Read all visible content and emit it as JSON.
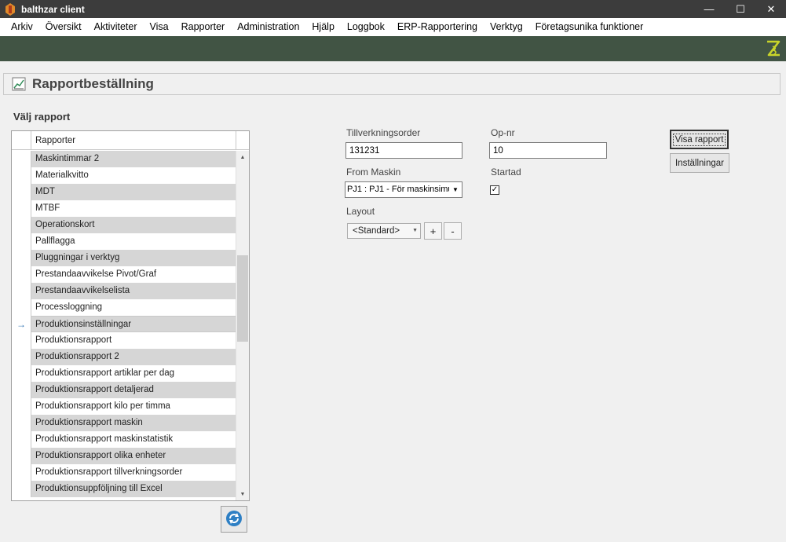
{
  "window": {
    "title": "balthzar client",
    "minimize": "—",
    "maximize": "☐",
    "close": "✕"
  },
  "menu": [
    "Arkiv",
    "Översikt",
    "Aktiviteter",
    "Visa",
    "Rapporter",
    "Administration",
    "Hjälp",
    "Loggbok",
    "ERP-Rapportering",
    "Verktyg",
    "Företagsunika funktioner"
  ],
  "header": {
    "title": "Rapportbeställning"
  },
  "report_list": {
    "section_label": "Välj rapport",
    "column_header": "Rapporter",
    "current_marker": "→",
    "rows": [
      "Maskintimmar 2",
      "Materialkvitto",
      "MDT",
      "MTBF",
      "Operationskort",
      "Pallflagga",
      "Pluggningar i verktyg",
      "Prestandaavvikelse Pivot/Graf",
      "Prestandaavvikelselista",
      "Processloggning",
      "Produktionsinställningar",
      "Produktionsrapport",
      "Produktionsrapport 2",
      "Produktionsrapport artiklar per dag",
      "Produktionsrapport detaljerad",
      "Produktionsrapport kilo per timma",
      "Produktionsrapport maskin",
      "Produktionsrapport maskinstatistik",
      "Produktionsrapport olika enheter",
      "Produktionsrapport tillverkningsorder",
      "Produktionsuppföljning till Excel"
    ],
    "current_index": 10
  },
  "form": {
    "order_label": "Tillverkningsorder",
    "order_value": "131231",
    "opnr_label": "Op-nr",
    "opnr_value": "10",
    "machine_label": "From Maskin",
    "machine_value": "PJ1 : PJ1 - För maskinsimu",
    "started_label": "Startad",
    "started_checked": true,
    "layout_label": "Layout",
    "layout_value": "<Standard>",
    "add_label": "+",
    "remove_label": "-"
  },
  "buttons": {
    "show_report": "Visa rapport",
    "settings": "Inställningar"
  },
  "colors": {
    "titlebar": "#3c3c3c",
    "greenbar": "#415444",
    "alt_row": "#d6d6d6",
    "logo": "#c9d42a"
  }
}
